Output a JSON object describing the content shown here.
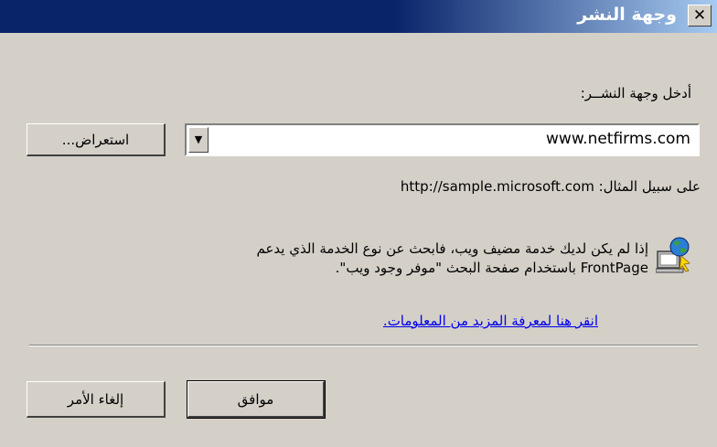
{
  "window": {
    "title": "وجهة النشر",
    "close_symbol": "✕"
  },
  "destination": {
    "label": "أدخل وجهة النشــر:",
    "value": "www.netfirms.com",
    "browse_label": "استعراض...",
    "example": "على سبيل المثال: http://sample.microsoft.com"
  },
  "info": {
    "line1": "إذا لم يكن لديك خدمة مضيف ويب، فابحث عن نوع الخدمة الذي يدعم",
    "line2": "FrontPage باستخدام صفحة البحث \"موفر وجود ويب\".",
    "icon": "globe-computer-icon"
  },
  "link_text": "انقر هنا لمعرفة المزيد من المعلومات.",
  "buttons": {
    "ok": "موافق",
    "cancel": "إلغاء الأمر"
  }
}
